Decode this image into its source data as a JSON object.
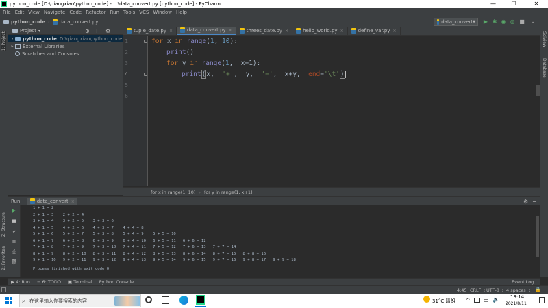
{
  "window": {
    "title": "python_code [D:\\qiangxiao\\python_code] - ...\\data_convert.py [python_code] - PyCharm",
    "minimize": "—",
    "maximize": "☐",
    "close": "✕"
  },
  "menu": [
    "File",
    "Edit",
    "View",
    "Navigate",
    "Code",
    "Refactor",
    "Run",
    "Tools",
    "VCS",
    "Window",
    "Help"
  ],
  "navbar": {
    "project": "python_code",
    "file": "data_convert.py",
    "run_config": "data_convert",
    "run_config_arrow": "▼"
  },
  "left_strip": {
    "project_label": "1: Project",
    "structure_label": "Z: Structure",
    "favorites_label": "2: Favorites"
  },
  "right_strip": {
    "scview_label": "SciView",
    "database_label": "Database"
  },
  "project_panel": {
    "header": "Project",
    "header_arrow": "▾",
    "items": [
      {
        "name": "python_code",
        "path": "D:\\qiangxiao\\python_code",
        "expanded": "▾"
      },
      {
        "name": "External Libraries",
        "expanded": "▸"
      },
      {
        "name": "Scratches and Consoles"
      }
    ]
  },
  "tabs": [
    {
      "label": "tuple_date.py",
      "close": "×"
    },
    {
      "label": "data_convert.py",
      "close": "×"
    },
    {
      "label": "threes_date.py",
      "close": "×"
    },
    {
      "label": "hello_world.py",
      "close": "×"
    },
    {
      "label": "define_var.py",
      "close": "×"
    }
  ],
  "line_numbers": [
    "1",
    "2",
    "3",
    "4",
    "5",
    "6"
  ],
  "code": {
    "l1_kw": "for",
    "l1_var": " x ",
    "l1_in": "in",
    "l1_fn": " range",
    "l1_p1": "(",
    "l1_n1": "1",
    "l1_c": ", ",
    "l1_n2": "10",
    "l1_p2": "):",
    "l2_fn": "print",
    "l2_p": "()",
    "l3_kw": "for",
    "l3_var": " y ",
    "l3_in": "in",
    "l3_fn": " range",
    "l3_p1": "(",
    "l3_n1": "1",
    "l3_c": ",  ",
    "l3_rest": "x+1):",
    "l4_fn": "print",
    "l4_p1": "(",
    "l4_a": "x,  ",
    "l4_s1": "'+'",
    "l4_b": ",  y,  ",
    "l4_s2": "'='",
    "l4_c": ",  x+y,  ",
    "l4_end": "end",
    "l4_eq": "=",
    "l4_s3": "'\\t'",
    "l4_p2": ")"
  },
  "editor_breadcrumb": [
    "for x in range(1, 10)",
    "for y in range(1, x+1)"
  ],
  "run_panel": {
    "label": "Run:",
    "config": "data_convert",
    "console_lines": [
      "1 + 1 = 2",
      "2 + 1 = 3    2 + 2 = 4",
      "3 + 1 = 4    3 + 2 = 5    3 + 3 = 6",
      "4 + 1 = 5    4 + 2 = 6    4 + 3 = 7    4 + 4 = 8",
      "5 + 1 = 6    5 + 2 = 7    5 + 3 = 8    5 + 4 = 9    5 + 5 = 10",
      "6 + 1 = 7    6 + 2 = 8    6 + 3 = 9    6 + 4 = 10   6 + 5 = 11   6 + 6 = 12",
      "7 + 1 = 8    7 + 2 = 9    7 + 3 = 10   7 + 4 = 11   7 + 5 = 12   7 + 6 = 13   7 + 7 = 14",
      "8 + 1 = 9    8 + 2 = 10   8 + 3 = 11   8 + 4 = 12   8 + 5 = 13   8 + 6 = 14   8 + 7 = 15   8 + 8 = 16",
      "9 + 1 = 10   9 + 2 = 11   9 + 3 = 12   9 + 4 = 13   9 + 5 = 14   9 + 6 = 15   9 + 7 = 16   9 + 8 = 17   9 + 9 = 18",
      "",
      "Process finished with exit code 0"
    ]
  },
  "bottom_tabs": [
    "▶ 4: Run",
    "≡ 6: TODO",
    "▣ Terminal",
    "Python Console"
  ],
  "event_log": "Event Log",
  "status": {
    "position": "4:45",
    "line_sep": "CRLF ÷",
    "encoding": "UTF-8 ÷",
    "indent": "4 spaces ÷"
  },
  "taskbar": {
    "search_placeholder": "在这里输入你要搜索的内容",
    "weather": "31°C 晴朗",
    "time": "13:14",
    "date": "2021/8/11"
  },
  "colors": {
    "accent": "#4a88c7",
    "keyword": "#cc7832",
    "builtin": "#8888c6",
    "number": "#6897bb",
    "string": "#6a8759",
    "run_green": "#59a869"
  }
}
